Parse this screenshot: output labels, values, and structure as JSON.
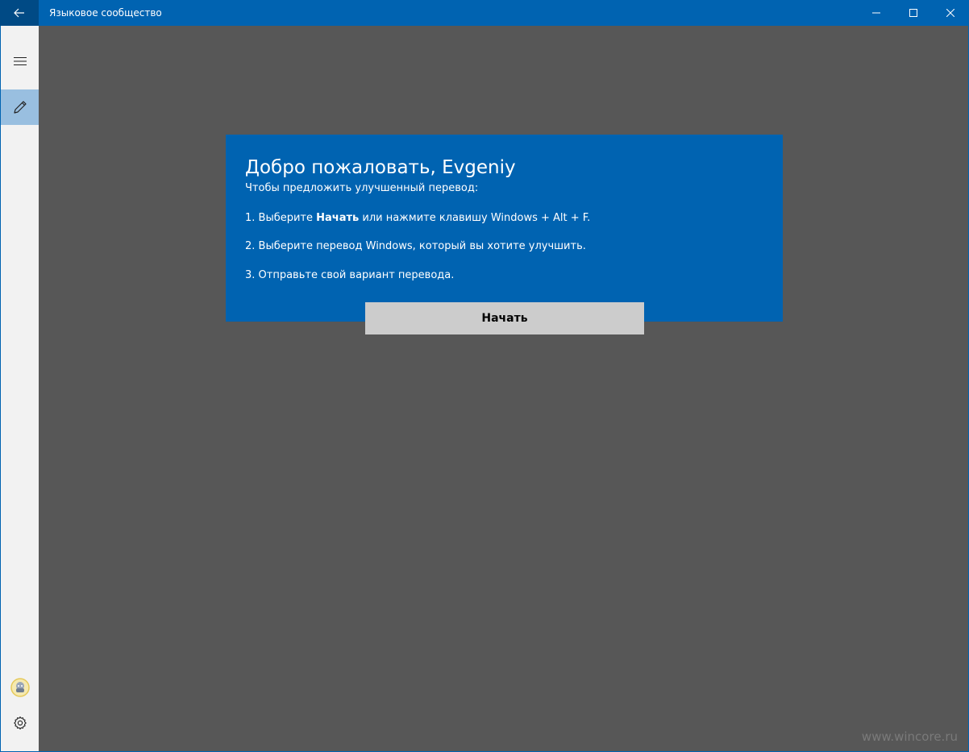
{
  "window": {
    "title": "Языковое сообщество"
  },
  "titlebar": {
    "back_icon": "arrow-left-icon",
    "minimize_icon": "minimize-icon",
    "maximize_icon": "maximize-icon",
    "close_icon": "close-icon"
  },
  "navpane": {
    "items": [
      {
        "name": "menu",
        "icon": "hamburger-icon",
        "selected": false
      },
      {
        "name": "edit",
        "icon": "pencil-icon",
        "selected": true
      },
      {
        "name": "avatar",
        "icon": "avatar-icon",
        "selected": false
      },
      {
        "name": "settings",
        "icon": "gear-icon",
        "selected": false
      }
    ]
  },
  "welcome": {
    "title": "Добро пожаловать, Evgeniy",
    "subtitle": "Чтобы предложить улучшенный перевод:",
    "step1_prefix": "1. Выберите ",
    "step1_bold": "Начать",
    "step1_suffix": " или нажмите клавишу Windows + Alt + F.",
    "step2": "2. Выберите перевод Windows, который вы хотите улучшить.",
    "step3": "3. Отправьте свой вариант перевода.",
    "start_label": "Начать"
  },
  "watermark": "www.wincore.ru",
  "colors": {
    "accent": "#0063b1",
    "background": "#575757",
    "navpane": "#f2f2f2",
    "nav_selected": "#99bfe0",
    "button": "#cccccc"
  }
}
